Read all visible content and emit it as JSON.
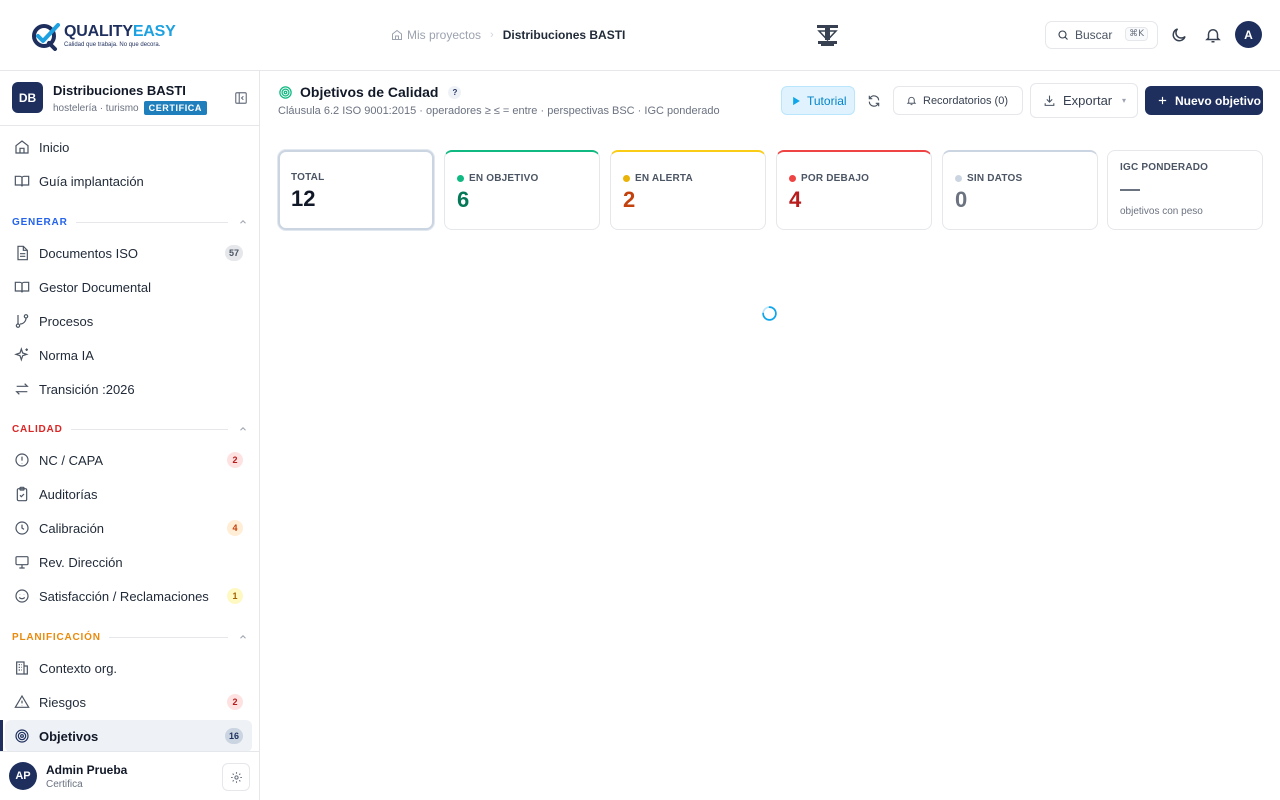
{
  "brand": {
    "name_part1": "QUALITY",
    "name_part2": "EASY",
    "tagline": "Calidad que trabaja. No que decora.",
    "colors": {
      "navy": "#1e2f5e",
      "cyan": "#1ea1e0"
    }
  },
  "breadcrumb": {
    "home_icon": "home-icon",
    "items": [
      "Mis proyectos",
      "Distribuciones BASTI"
    ]
  },
  "header": {
    "search_label": "Buscar",
    "search_shortcut": "⌘K",
    "avatar_initial": "A",
    "icons": [
      "moon-icon",
      "bell-icon"
    ]
  },
  "project": {
    "initials": "DB",
    "name": "Distribuciones BASTI",
    "sector": "hostelería · turismo",
    "badge": "CERTIFICA"
  },
  "sidebar": {
    "top_items": [
      {
        "label": "Inicio",
        "icon": "home-icon"
      },
      {
        "label": "Guía implantación",
        "icon": "book-open-icon"
      }
    ],
    "sections": [
      {
        "title": "GENERAR",
        "color": "#2563eb",
        "items": [
          {
            "label": "Documentos ISO",
            "icon": "file-text-icon",
            "count": "57"
          },
          {
            "label": "Gestor Documental",
            "icon": "book-icon",
            "count": ""
          },
          {
            "label": "Procesos",
            "icon": "git-branch-icon",
            "count": ""
          },
          {
            "label": "Norma IA",
            "icon": "sparkles-icon",
            "count": ""
          },
          {
            "label": "Transición :2026",
            "icon": "arrows-icon",
            "count": ""
          }
        ]
      },
      {
        "title": "CALIDAD",
        "color": "#dc2626",
        "items": [
          {
            "label": "NC / CAPA",
            "icon": "alert-circle-icon",
            "count": "2"
          },
          {
            "label": "Auditorías",
            "icon": "clipboard-check-icon",
            "count": ""
          },
          {
            "label": "Calibración",
            "icon": "clock-icon",
            "count": "4"
          },
          {
            "label": "Rev. Dirección",
            "icon": "monitor-icon",
            "count": ""
          },
          {
            "label": "Satisfacción / Reclamaciones",
            "icon": "smile-icon",
            "count": "1"
          }
        ]
      },
      {
        "title": "PLANIFICACIÓN",
        "color": "#ea8a0c",
        "items": [
          {
            "label": "Contexto org.",
            "icon": "building-icon",
            "count": ""
          },
          {
            "label": "Riesgos",
            "icon": "warning-triangle-icon",
            "count": "2"
          },
          {
            "label": "Objetivos",
            "icon": "target-icon",
            "count": "16",
            "active": true
          }
        ]
      }
    ]
  },
  "user": {
    "initials": "AP",
    "name": "Admin Prueba",
    "role": "Certifica"
  },
  "page": {
    "title": "Objetivos de Calidad",
    "help": "?",
    "subtitle": "Cláusula 6.2 ISO 9001:2015 · operadores ≥ ≤ = entre · perspectivas BSC · IGC ponderado",
    "buttons": {
      "tutorial": "Tutorial",
      "reminders": "Recordatorios (0)",
      "export": "Exportar",
      "new": "Nuevo objetivo"
    }
  },
  "stats": [
    {
      "label": "TOTAL",
      "value": "12",
      "color": "#111827"
    },
    {
      "label": "EN OBJETIVO",
      "value": "6",
      "color": "#047857",
      "dot": "#10b981"
    },
    {
      "label": "EN ALERTA",
      "value": "2",
      "color": "#c2410c",
      "dot": "#eab308"
    },
    {
      "label": "POR DEBAJO",
      "value": "4",
      "color": "#b91c1c",
      "dot": "#ef4444"
    },
    {
      "label": "SIN DATOS",
      "value": "0",
      "color": "#6b7280",
      "dot": "#cbd5e1"
    }
  ],
  "igc": {
    "label": "IGC PONDERADO",
    "note": "objetivos con peso"
  }
}
